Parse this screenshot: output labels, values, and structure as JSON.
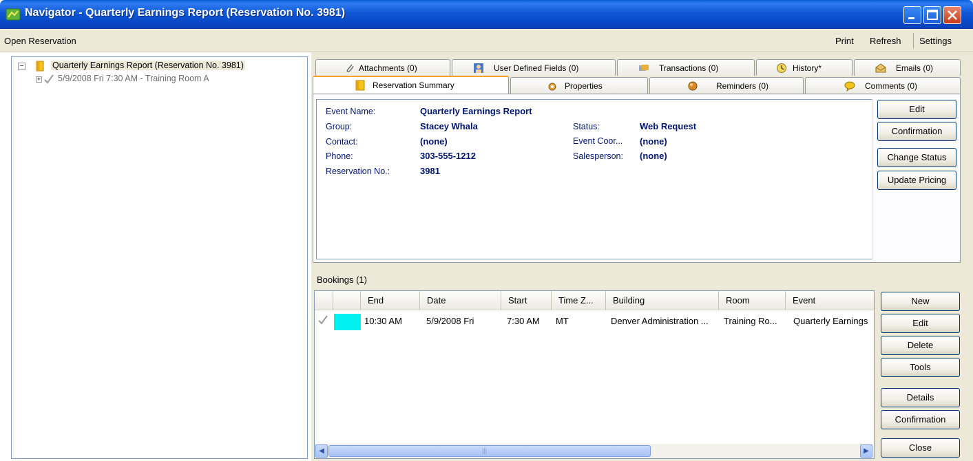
{
  "window": {
    "title": "Navigator - Quarterly Earnings Report (Reservation No. 3981)",
    "controls": [
      "minimize-icon",
      "maximize-icon",
      "close-icon"
    ]
  },
  "menubar": {
    "left": "Open Reservation",
    "print": "Print",
    "refresh": "Refresh",
    "settings": "Settings"
  },
  "tree": {
    "root_label": "Quarterly Earnings Report (Reservation No. 3981)",
    "root_expander": "−",
    "child_label": "5/9/2008 Fri 7:30 AM - Training Room A",
    "child_expander": "+"
  },
  "tabs": {
    "row1": [
      {
        "label": "Attachments (0)",
        "icon": "paperclip-icon"
      },
      {
        "label": "User Defined Fields (0)",
        "icon": "user-fields-icon"
      },
      {
        "label": "Transactions (0)",
        "icon": "transactions-icon"
      },
      {
        "label": "History*",
        "icon": "history-icon"
      },
      {
        "label": "Emails (0)",
        "icon": "email-icon"
      }
    ],
    "row2": [
      {
        "label": "Reservation Summary",
        "icon": "folder-icon",
        "active": true
      },
      {
        "label": "Properties",
        "icon": "properties-gear-icon"
      },
      {
        "label": "Reminders (0)",
        "icon": "reminder-icon"
      },
      {
        "label": "Comments (0)",
        "icon": "comment-icon"
      }
    ]
  },
  "summary": {
    "event_name_label": "Event Name:",
    "event_name": "Quarterly Earnings Report",
    "group_label": "Group:",
    "group": "Stacey Whala",
    "contact_label": "Contact:",
    "contact": "(none)",
    "phone_label": "Phone:",
    "phone": "303-555-1212",
    "reservation_label": "Reservation No.:",
    "reservation_no": "3981",
    "status_label": "Status:",
    "status": "Web Request",
    "coordinator_label": "Event Coor...",
    "coordinator": "(none)",
    "salesperson_label": "Salesperson:",
    "salesperson": "(none)"
  },
  "summary_buttons": {
    "edit": "Edit",
    "confirmation": "Confirmation",
    "change_status": "Change Status",
    "update_pricing": "Update Pricing"
  },
  "bookings": {
    "label": "Bookings (1)",
    "columns": [
      "End",
      "Date",
      "Start",
      "Time Z...",
      "Building",
      "Room",
      "Event"
    ],
    "rows": [
      {
        "color": "#00f0f0",
        "end": "10:30 AM",
        "date": "5/9/2008 Fri",
        "start": "7:30 AM",
        "timezone": "MT",
        "building": "Denver Administration ...",
        "room": "Training Ro...",
        "event": "Quarterly Earnings"
      }
    ]
  },
  "booking_buttons": {
    "new": "New",
    "edit": "Edit",
    "delete": "Delete",
    "tools": "Tools",
    "details": "Details",
    "confirmation": "Confirmation",
    "close": "Close"
  },
  "scrollbar": {
    "left_arrow": "◀",
    "right_arrow": "▶",
    "grip": "|||"
  }
}
